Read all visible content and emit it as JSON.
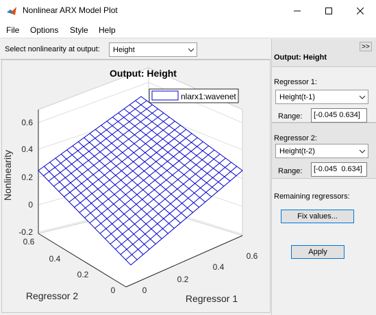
{
  "window": {
    "title": "Nonlinear ARX Model Plot",
    "icons": [
      "matlab-icon",
      "minimize-icon",
      "maximize-icon",
      "close-icon"
    ]
  },
  "menu": {
    "items": [
      {
        "label": "File"
      },
      {
        "label": "Options"
      },
      {
        "label": "Style"
      },
      {
        "label": "Help"
      }
    ]
  },
  "selector": {
    "label": "Select nonlinearity at output:",
    "value": "Height"
  },
  "plot": {
    "title": "Output: Height",
    "legend": "nlarx1:wavenet",
    "zlabel": "Nonlinearity",
    "xlabel": "Regressor 1",
    "ylabel": "Regressor 2",
    "z_ticks": [
      "-0.2",
      "0",
      "0.2",
      "0.4",
      "0.6"
    ],
    "x_ticks": [
      "0",
      "0.2",
      "0.4",
      "0.6"
    ],
    "y_ticks": [
      "0",
      "0.2",
      "0.4",
      "0.6"
    ],
    "line_color": "#0000cc"
  },
  "side": {
    "expand_label": ">>",
    "header": "Output: Height",
    "regressor1": {
      "label": "Regressor 1:",
      "value": "Height(t-1)",
      "range_label": "Range:",
      "range_value": "[-0.045 0.634]"
    },
    "regressor2": {
      "label": "Regressor 2:",
      "value": "Height(t-2)",
      "range_label": "Range:",
      "range_value": "[-0.045  0.634]"
    },
    "remaining_label": "Remaining regressors:",
    "fix_button": "Fix values...",
    "apply_button": "Apply"
  }
}
